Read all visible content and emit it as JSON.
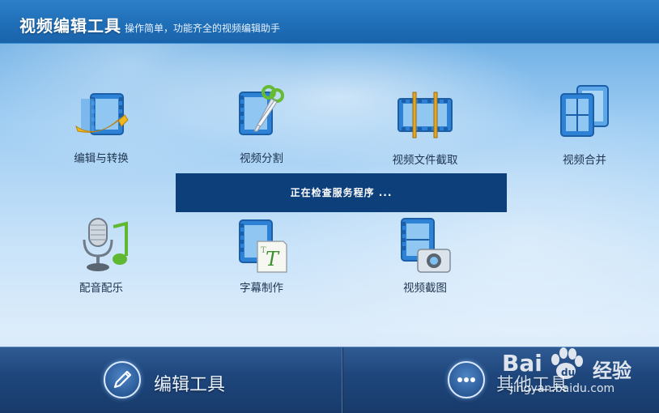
{
  "header": {
    "title": "视频编辑工具",
    "subtitle": "操作简单，功能齐全的视频编辑助手"
  },
  "tools": [
    {
      "label": "编辑与转换",
      "icon": "film-arrow-icon"
    },
    {
      "label": "视频分割",
      "icon": "film-scissors-icon"
    },
    {
      "label": "视频文件截取",
      "icon": "film-clip-icon"
    },
    {
      "label": "视频合并",
      "icon": "film-merge-icon"
    },
    {
      "label": "配音配乐",
      "icon": "microphone-music-icon"
    },
    {
      "label": "字幕制作",
      "icon": "film-subtitle-icon"
    },
    {
      "label": "视频截图",
      "icon": "film-camera-icon"
    }
  ],
  "status": {
    "text": "正在检查服务程序 ..."
  },
  "bottom_tabs": [
    {
      "label": "编辑工具",
      "icon": "pencil-icon"
    },
    {
      "label": "其他工具",
      "icon": "more-icon"
    }
  ],
  "watermark": {
    "brand": "Bai",
    "brand2": "经验",
    "url": "jingyan.baidu.com"
  }
}
